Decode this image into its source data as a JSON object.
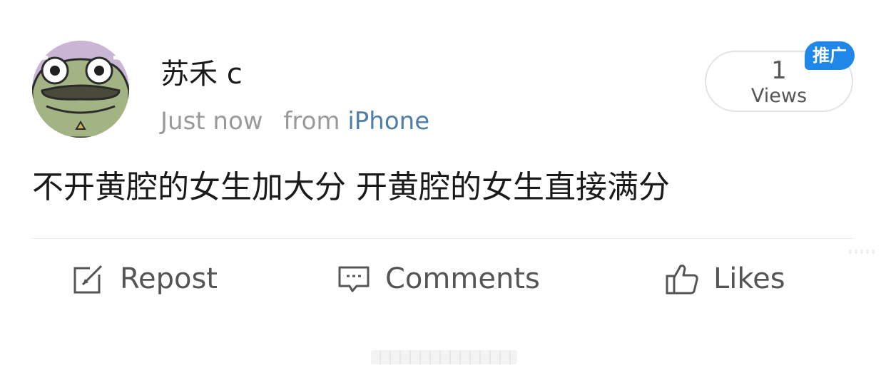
{
  "post": {
    "author": "苏禾 c",
    "time": "Just now",
    "from_label": "from",
    "device": "iPhone",
    "text": "不开黄腔的女生加大分 开黄腔的女生直接满分"
  },
  "stats": {
    "views_count": "1",
    "views_label": "Views",
    "promo_label": "推广"
  },
  "actions": {
    "repost": "Repost",
    "comments": "Comments",
    "likes": "Likes"
  },
  "icons": {
    "avatar": "frog-avatar",
    "repost": "repost-icon",
    "comments": "comment-icon",
    "likes": "thumbs-up-icon"
  },
  "colors": {
    "accent_link": "#4f7ea6",
    "badge_blue": "#1f87e8",
    "secondary_text": "#9a9a9a",
    "action_text": "#555555"
  }
}
